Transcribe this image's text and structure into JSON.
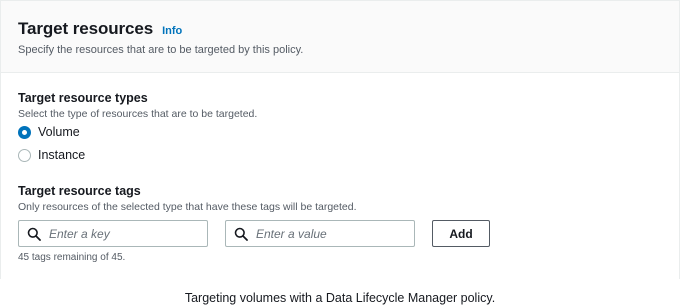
{
  "panel": {
    "title": "Target resources",
    "info_label": "Info",
    "description": "Specify the resources that are to be targeted by this policy."
  },
  "resource_types": {
    "label": "Target resource types",
    "description": "Select the type of resources that are to be targeted.",
    "options": [
      {
        "label": "Volume",
        "selected": true
      },
      {
        "label": "Instance",
        "selected": false
      }
    ]
  },
  "resource_tags": {
    "label": "Target resource tags",
    "description": "Only resources of the selected type that have these tags will be targeted.",
    "key_placeholder": "Enter a key",
    "value_placeholder": "Enter a value",
    "add_label": "Add",
    "remaining_text": "45 tags remaining of 45."
  },
  "caption": "Targeting volumes with a Data Lifecycle Manager policy.",
  "colors": {
    "accent": "#0073bb",
    "header_bg": "#fafafa",
    "border": "#aab7b8"
  }
}
